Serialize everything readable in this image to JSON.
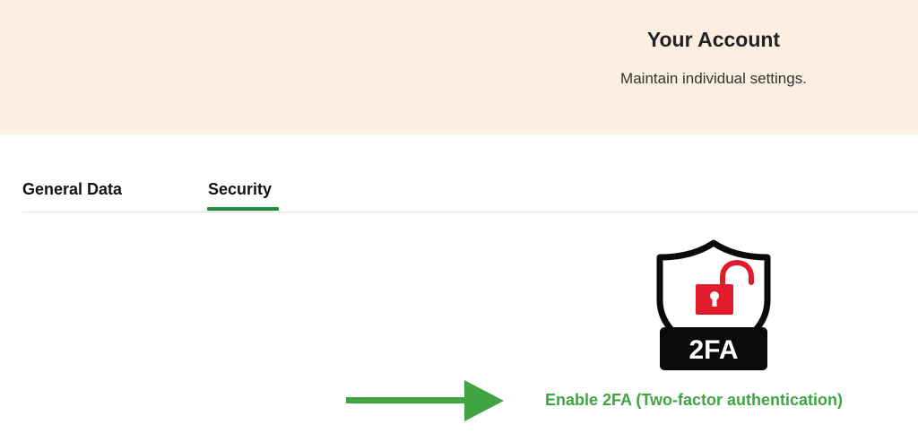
{
  "header": {
    "title": "Your Account",
    "subtitle": "Maintain individual settings."
  },
  "tabs": [
    {
      "label": "General Data",
      "active": false
    },
    {
      "label": "Security",
      "active": true
    }
  ],
  "security": {
    "badge_icon": "2fa-shield-unlocked-icon",
    "badge_text": "2FA",
    "enable_link_label": "Enable 2FA (Two-factor authentication)",
    "arrow_icon": "arrow-right-icon"
  },
  "colors": {
    "header_bg": "#fcefe1",
    "accent_green": "#1f8f3a",
    "link_green": "#3fa442",
    "lock_red": "#e21b2c"
  }
}
